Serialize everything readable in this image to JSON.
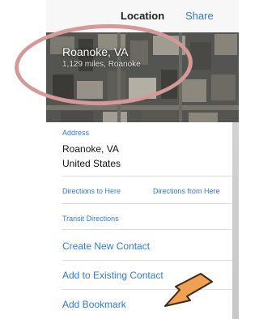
{
  "nav": {
    "title": "Location",
    "share_label": "Share"
  },
  "map": {
    "place_name": "Roanoke, VA",
    "distance": "1,129 miles, Roanoke"
  },
  "address": {
    "label": "Address",
    "line1": "Roanoke, VA",
    "line2": "United States"
  },
  "directions": {
    "to_here": "Directions to Here",
    "from_here": "Directions from Here",
    "transit": "Transit Directions"
  },
  "actions": [
    {
      "label": "Create New Contact"
    },
    {
      "label": "Add to Existing Contact"
    },
    {
      "label": "Add Bookmark"
    }
  ],
  "colors": {
    "link_blue": "#2f7ad9",
    "annotation_oval": "#d49a9a",
    "annotation_arrow": "#f0a050"
  },
  "icons": {
    "annotation_arrow": "arrow-pointing-to-add-bookmark"
  }
}
